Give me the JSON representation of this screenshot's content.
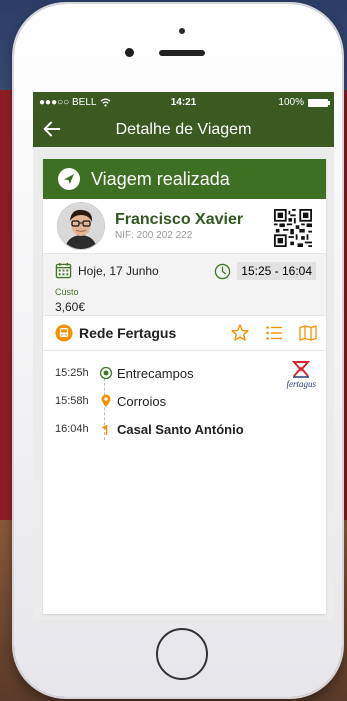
{
  "status_bar": {
    "carrier": "●●●○○ BELL",
    "time": "14:21",
    "battery": "100%"
  },
  "app_bar": {
    "title": "Detalhe de Viagem"
  },
  "trip": {
    "status": "Viagem realizada"
  },
  "user": {
    "name": "Francisco Xavier",
    "nif": "NIF: 200 202 222"
  },
  "meta": {
    "date": "Hoje, 17 Junho",
    "time_start": "15:25",
    "time_sep": " - ",
    "time_end": "16:04",
    "cost_label": "Custo",
    "cost_value": "3,60€"
  },
  "route": {
    "name": "Rede Fertagus"
  },
  "stops": [
    {
      "time": "15:25h",
      "name": "Entrecampos",
      "icon": "origin-dot-icon"
    },
    {
      "time": "15:58h",
      "name": "Corroios",
      "icon": "pin-icon"
    },
    {
      "time": "16:04h",
      "name": "Casal Santo António",
      "icon": "flag-icon"
    }
  ],
  "operator": {
    "name": "fertagus"
  },
  "colors": {
    "primary": "#3a5a22",
    "banner": "#3e7023",
    "accent": "#f29200",
    "text_green": "#2f5a1f"
  }
}
